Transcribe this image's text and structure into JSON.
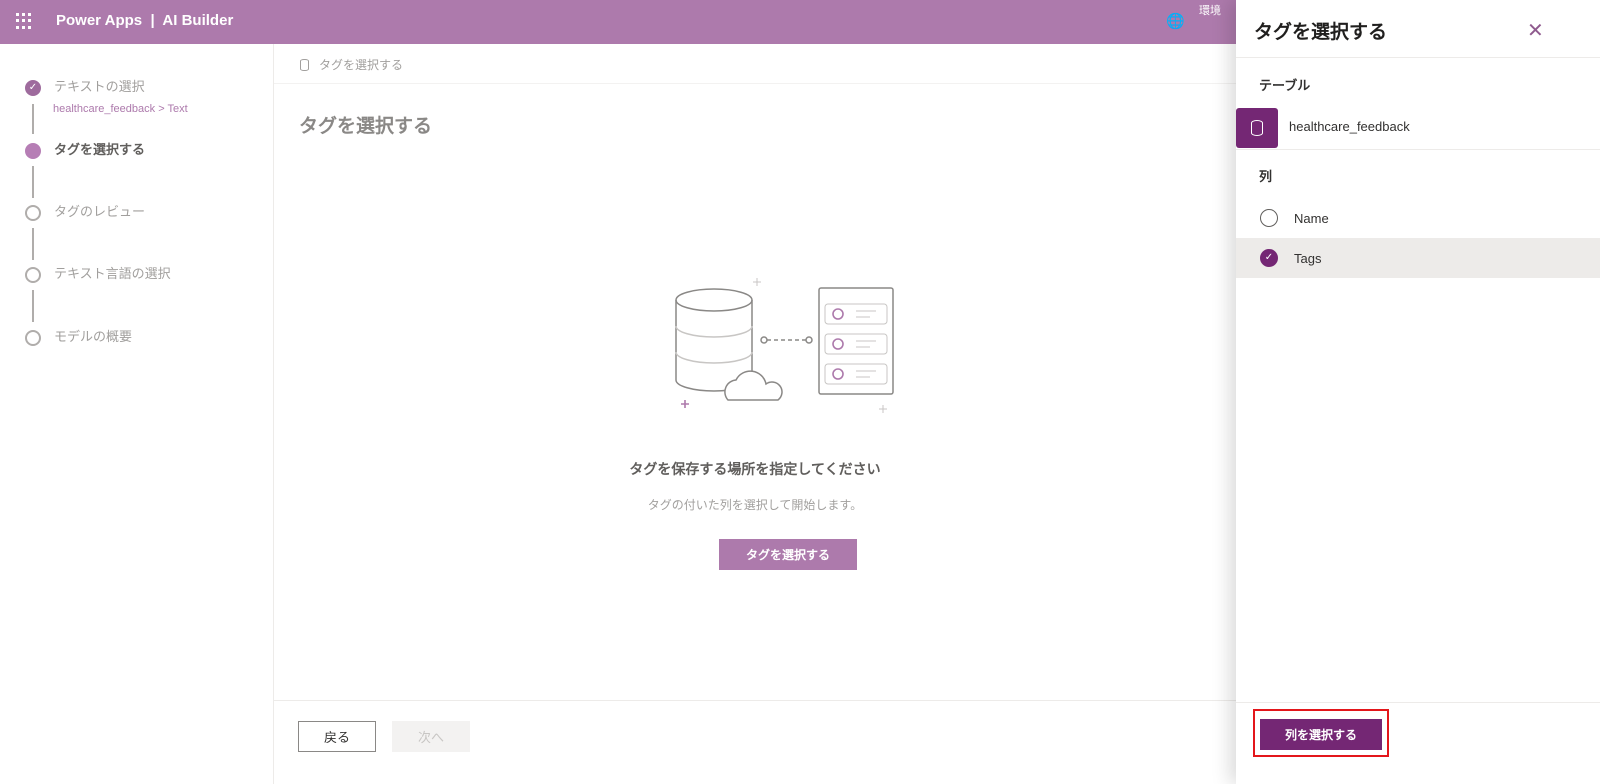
{
  "header": {
    "brand": "Power Apps  |  AI Builder",
    "env_label": "環境"
  },
  "steps": [
    {
      "label": "テキストの選択",
      "sub": "healthcare_feedback > Text",
      "state": "done"
    },
    {
      "label": "タグを選択する",
      "state": "current"
    },
    {
      "label": "タグのレビュー",
      "state": "todo"
    },
    {
      "label": "テキスト言語の選択",
      "state": "todo"
    },
    {
      "label": "モデルの概要",
      "state": "todo"
    }
  ],
  "main": {
    "breadcrumb": "タグを選択する",
    "title": "タグを選択する",
    "message": "タグを保存する場所を指定してください",
    "submessage": "タグの付いた列を選択して開始します。",
    "select_button": "タグを選択する",
    "back": "戻る",
    "next": "次へ"
  },
  "panel": {
    "title": "タグを選択する",
    "table_label": "テーブル",
    "table_name": "healthcare_feedback",
    "column_label": "列",
    "columns": [
      {
        "name": "Name",
        "selected": false
      },
      {
        "name": "Tags",
        "selected": true
      }
    ],
    "confirm": "列を選択する"
  },
  "colors": {
    "header": "#ad7aac",
    "accent": "#742774"
  }
}
